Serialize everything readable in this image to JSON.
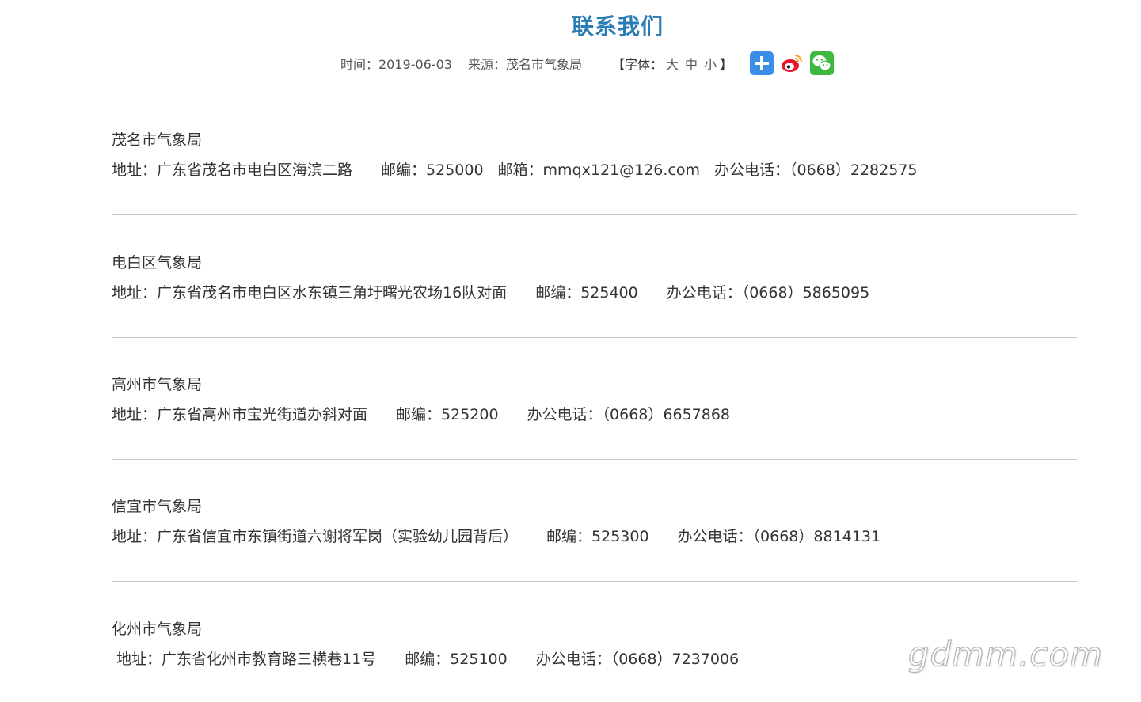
{
  "page": {
    "title": "联系我们",
    "time_label": "时间：2019-06-03",
    "source_label": "来源：茂名市气象局",
    "font_prefix": "【字体：",
    "font_large": "大",
    "font_medium": "中",
    "font_small": "小",
    "font_suffix": "】"
  },
  "share": {
    "icons": [
      "plus-share-icon",
      "weibo-icon",
      "wechat-icon"
    ],
    "colors": {
      "plus": "#3a8ee6",
      "weibo": "#e6162d",
      "wechat": "#3fb83f"
    }
  },
  "accent_color": "#2a7db5",
  "entries": [
    {
      "name": "茂名市气象局",
      "address": "地址：广东省茂名市电白区海滨二路",
      "postcode": "邮编：525000",
      "email": "邮箱：mmqx121@126.com",
      "phone": "办公电话：（0668）2282575"
    },
    {
      "name": "电白区气象局",
      "address": "地址：广东省茂名市电白区水东镇三角圩曙光农场16队对面",
      "postcode": "邮编：525400",
      "phone": "办公电话：（0668）5865095"
    },
    {
      "name": "高州市气象局",
      "address": "地址：广东省高州市宝光街道办斜对面",
      "postcode": "邮编：525200",
      "phone": "办公电话：（0668）6657868"
    },
    {
      "name": "信宜市气象局",
      "address": "地址：广东省信宜市东镇街道六谢将军岗（实验幼儿园背后）",
      "postcode": "邮编：525300",
      "phone": "办公电话：（0668）8814131"
    },
    {
      "name": "化州市气象局",
      "address": "地址：广东省化州市教育路三横巷11号",
      "postcode": "邮编：525100",
      "phone": "办公电话：（0668）7237006"
    }
  ],
  "watermark": "gdmm.com"
}
